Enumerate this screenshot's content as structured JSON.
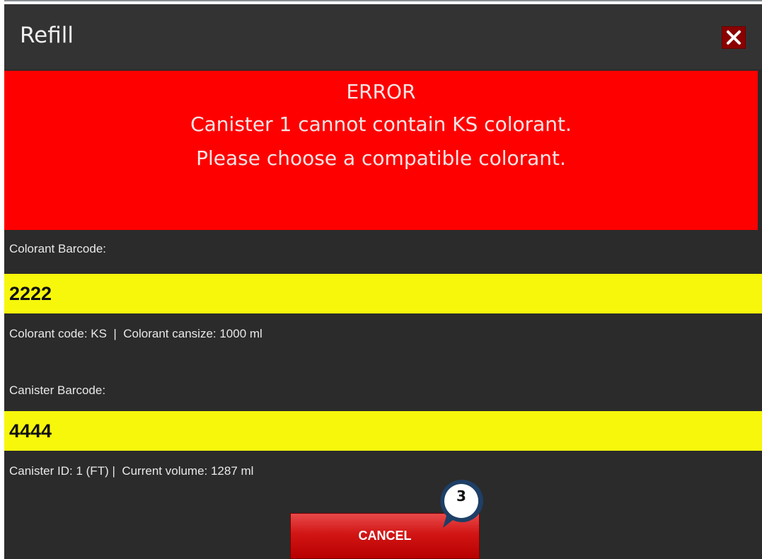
{
  "dialog": {
    "title": "Refill",
    "close_icon": "close-icon"
  },
  "error": {
    "heading": "ERROR",
    "message_line1": "Canister 1 cannot contain KS colorant.",
    "message_line2": "Please choose a compatible colorant."
  },
  "colorant": {
    "label": "Colorant Barcode:",
    "value": "2222",
    "info": "Colorant code: KS  |  Colorant cansize: 1000 ml"
  },
  "canister": {
    "label": "Canister Barcode:",
    "value": "4444",
    "info": "Canister ID: 1 (FT) |  Current volume: 1287 ml"
  },
  "actions": {
    "cancel_label": "CANCEL"
  },
  "callout": {
    "number": "3"
  },
  "colors": {
    "error_banner": "#ff0000",
    "input_highlight": "#f7f70c",
    "dialog_bg": "#2b2b2b",
    "cancel_button": "#d21515"
  }
}
